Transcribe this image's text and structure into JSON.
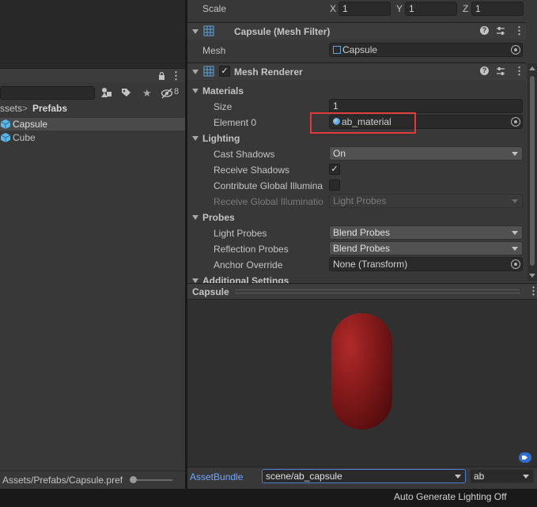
{
  "transform": {
    "scale_label": "Scale",
    "x_label": "X",
    "x": "1",
    "y_label": "Y",
    "y": "1",
    "z_label": "Z",
    "z": "1"
  },
  "mesh_filter": {
    "title": "Capsule (Mesh Filter)",
    "mesh_label": "Mesh",
    "mesh_value": "Capsule"
  },
  "mesh_renderer": {
    "title": "Mesh Renderer",
    "materials_label": "Materials",
    "size_label": "Size",
    "size_value": "1",
    "element0_label": "Element 0",
    "element0_value": "ab_material",
    "lighting_label": "Lighting",
    "cast_shadows_label": "Cast Shadows",
    "cast_shadows_value": "On",
    "receive_shadows_label": "Receive Shadows",
    "contribute_gi_label": "Contribute Global Illumina",
    "receive_gi_label": "Receive Global Illuminatio",
    "receive_gi_value": "Light Probes",
    "probes_label": "Probes",
    "light_probes_label": "Light Probes",
    "light_probes_value": "Blend Probes",
    "reflection_probes_label": "Reflection Probes",
    "reflection_probes_value": "Blend Probes",
    "anchor_override_label": "Anchor Override",
    "anchor_override_value": "None (Transform)",
    "additional_settings_label": "Additional Settings"
  },
  "preview": {
    "title": "Capsule",
    "capsule_color": "#8a1c1c"
  },
  "asset_bundle": {
    "label": "AssetBundle",
    "name": "scene/ab_capsule",
    "variant": "ab"
  },
  "project": {
    "breadcrumb_root": "ssets",
    "breadcrumb_sep": ">",
    "breadcrumb_current": "Prefabs",
    "items": [
      {
        "label": "Capsule"
      },
      {
        "label": "Cube"
      }
    ],
    "hidden_count": "8",
    "footer_path": "Assets/Prefabs/Capsule.pref"
  },
  "status_bar": {
    "text": "Auto Generate Lighting Off"
  },
  "colors": {
    "accent": "#4c7fd1",
    "highlight": "#e03a3a",
    "selected_row": "#4a4a4a"
  }
}
